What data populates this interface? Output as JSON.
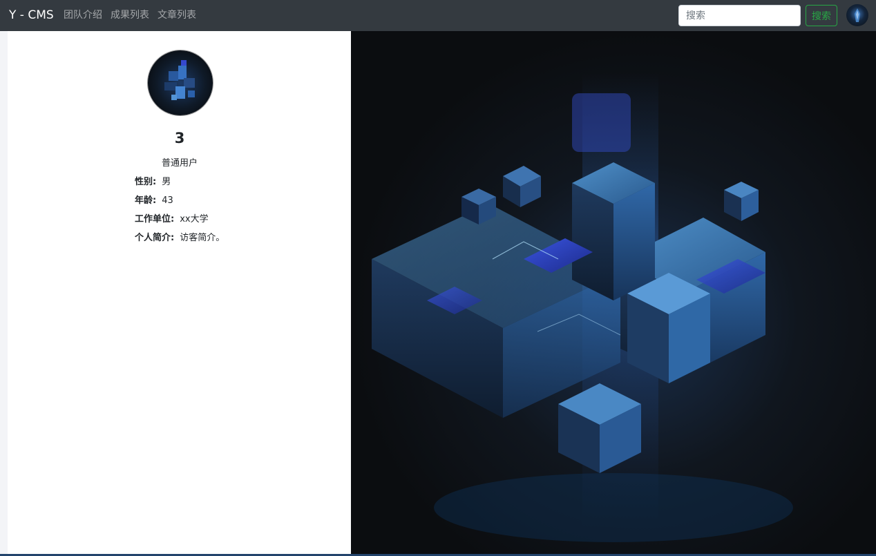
{
  "navbar": {
    "brand": "Y - CMS",
    "links": [
      "团队介绍",
      "成果列表",
      "文章列表"
    ],
    "search_placeholder": "搜索",
    "search_button": "搜索"
  },
  "profile": {
    "name": "3",
    "role": "普通用户",
    "fields": [
      {
        "label": "性别:",
        "value": "男"
      },
      {
        "label": "年龄:",
        "value": "43"
      },
      {
        "label": "工作单位:",
        "value": "xx大学"
      },
      {
        "label": "个人简介:",
        "value": "访客简介。"
      }
    ]
  },
  "colors": {
    "navbar_bg": "#343a40",
    "search_button": "#28a745"
  },
  "icons": {
    "nav_avatar": "user-avatar",
    "hero": "abstract-cubes-illustration"
  }
}
